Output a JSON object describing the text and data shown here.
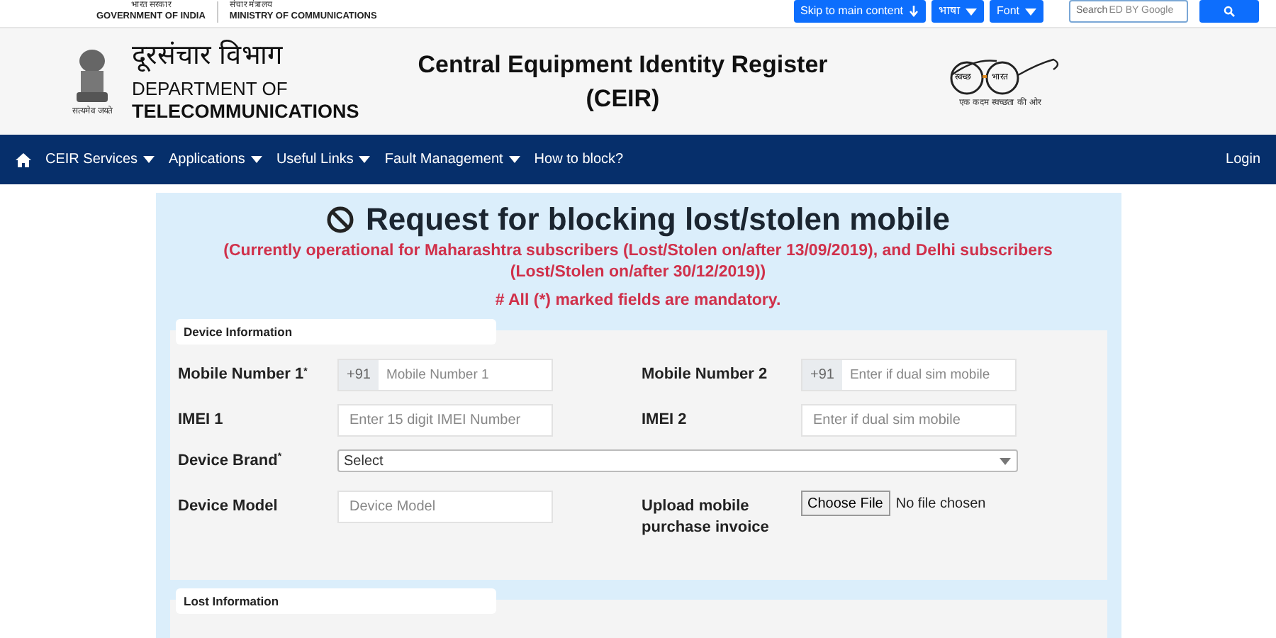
{
  "gov_links": [
    {
      "hindi": "भारत सरकार",
      "english": "GOVERNMENT OF INDIA"
    },
    {
      "hindi": "संचार मंत्रालय",
      "english": "MINISTRY OF COMMUNICATIONS"
    }
  ],
  "top_buttons": [
    {
      "label": "Skip to main content",
      "kind": "skip"
    },
    {
      "label": "भाषा",
      "kind": "dropdown"
    },
    {
      "label": "Font",
      "kind": "dropdown"
    }
  ],
  "search": {
    "placeholder": "Search",
    "branding": "ED BY Google"
  },
  "header": {
    "emblem_motto": "सत्यमेव जयते",
    "dept_hindi": "दूरसंचार विभाग",
    "dept_line1": "DEPARTMENT OF",
    "dept_line2": "TELECOMMUNICATIONS",
    "title_line1": "Central Equipment Identity Register",
    "title_line2": "(CEIR)",
    "swachh_left": "स्वच्छ",
    "swachh_right": "भारत",
    "swachh_tagline": "एक कदम स्वच्छता की ओर"
  },
  "nav": {
    "items": [
      {
        "label": "CEIR Services",
        "dropdown": true
      },
      {
        "label": "Applications",
        "dropdown": true
      },
      {
        "label": "Useful Links",
        "dropdown": true
      },
      {
        "label": "Fault Management",
        "dropdown": true
      },
      {
        "label": "How to block?",
        "dropdown": false
      }
    ],
    "login": "Login"
  },
  "page": {
    "title": "Request for blocking lost/stolen mobile",
    "notice": "(Currently operational for Maharashtra subscribers (Lost/Stolen on/after 13/09/2019), and Delhi subscribers (Lost/Stolen on/after 30/12/2019))",
    "mandatory": "# All (*) marked fields are mandatory."
  },
  "device_section": {
    "legend": "Device Information",
    "fields": [
      {
        "label": "Mobile Number 1",
        "required_mark": "*",
        "kind": "phone",
        "prefix": "+91",
        "placeholder": "Mobile Number 1"
      },
      {
        "label": "Mobile Number 2",
        "kind": "phone",
        "prefix": "+91",
        "placeholder": "Enter if dual sim mobile"
      },
      {
        "label": "IMEI 1",
        "kind": "text",
        "placeholder": "Enter 15 digit IMEI Number"
      },
      {
        "label": "IMEI 2",
        "kind": "text",
        "placeholder": "Enter if dual sim mobile"
      },
      {
        "label": "Device Brand",
        "required_mark": "*",
        "kind": "select",
        "value": "Select"
      },
      {
        "label": "Device Model",
        "kind": "text",
        "placeholder": "Device Model"
      },
      {
        "label": "Upload mobile purchase invoice",
        "kind": "file",
        "button": "Choose File",
        "status": "No file chosen"
      }
    ]
  },
  "lost_section": {
    "legend": "Lost Information"
  }
}
